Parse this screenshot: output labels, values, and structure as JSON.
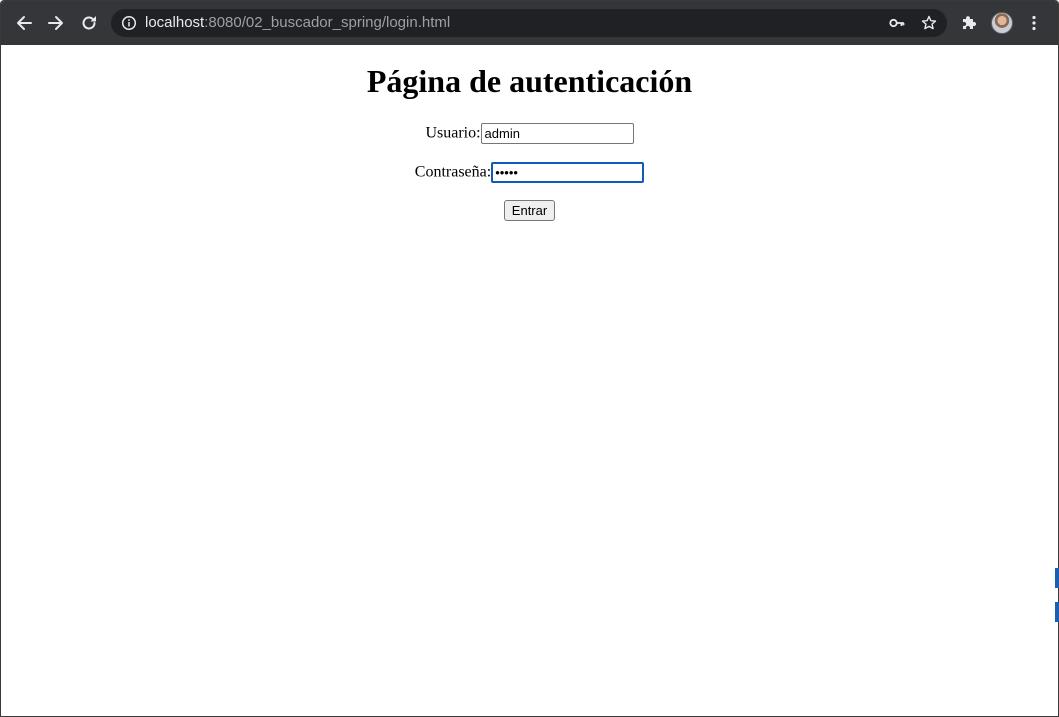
{
  "browser": {
    "url_host": "localhost",
    "url_path": ":8080/02_buscador_spring/login.html",
    "icons": {
      "back": "arrow-left",
      "forward": "arrow-right",
      "reload": "reload",
      "site_info": "info-circle",
      "password": "key",
      "bookmark": "star-outline",
      "extensions": "puzzle-piece",
      "profile": "avatar",
      "menu": "three-dots-vertical"
    },
    "colors": {
      "toolbar_bg": "#35363a",
      "omnibox_bg": "#202124",
      "focus_ring": "#0f5bb8"
    }
  },
  "page": {
    "title": "Página de autenticación",
    "form": {
      "username_label": "Usuario:",
      "username_value": "admin",
      "password_label": "Contraseña:",
      "password_value": "•••••",
      "submit_label": "Entrar"
    }
  }
}
